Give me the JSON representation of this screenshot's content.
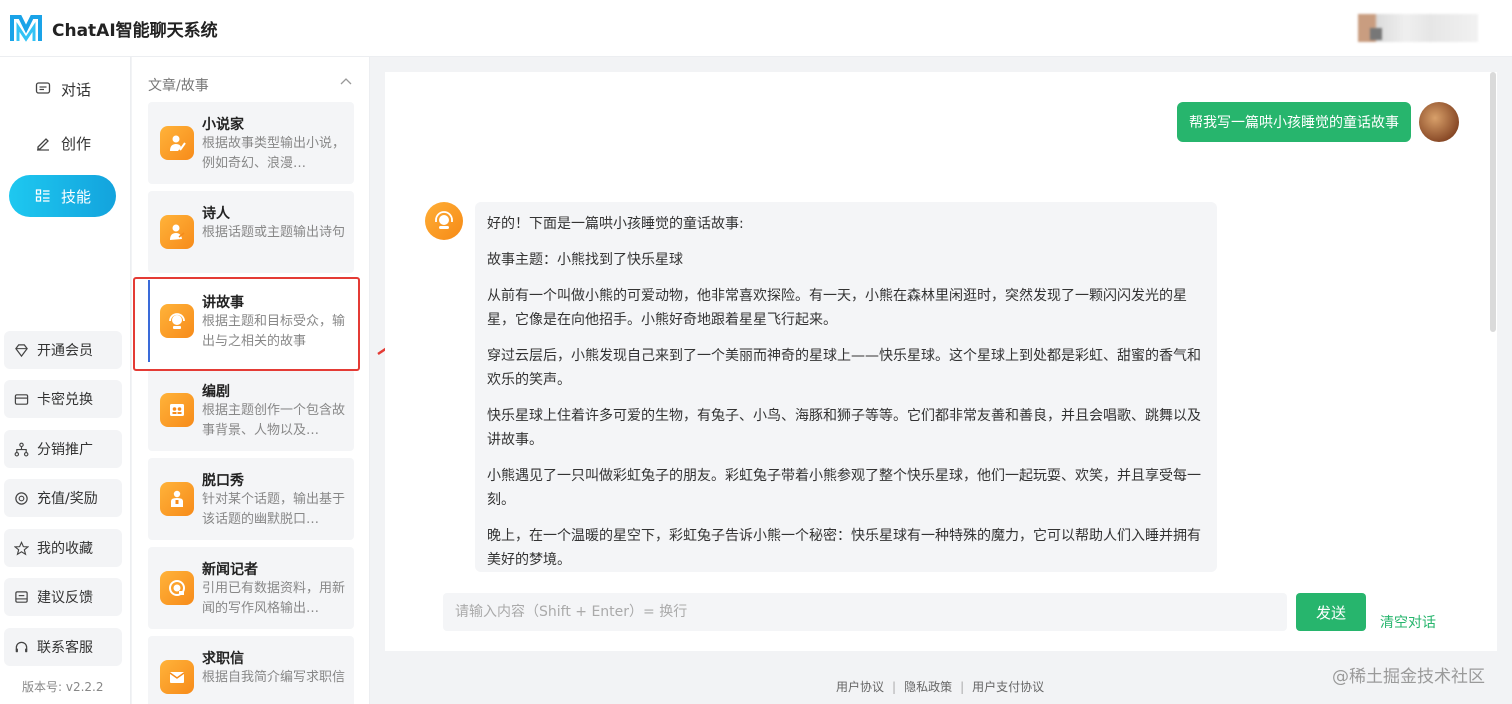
{
  "header": {
    "app_title": "ChatAI智能聊天系统",
    "logo_icon": "m-logo-icon"
  },
  "leftnav": {
    "items": [
      {
        "label": "对话",
        "icon": "chat-icon",
        "active": false
      },
      {
        "label": "创作",
        "icon": "pencil-icon",
        "active": false
      },
      {
        "label": "技能",
        "icon": "skills-grid-icon",
        "active": true
      }
    ],
    "buttons": [
      {
        "label": "开通会员",
        "icon": "diamond-icon"
      },
      {
        "label": "卡密兑换",
        "icon": "card-icon"
      },
      {
        "label": "分销推广",
        "icon": "share-tree-icon"
      },
      {
        "label": "充值/奖励",
        "icon": "coin-icon"
      },
      {
        "label": "我的收藏",
        "icon": "star-icon"
      },
      {
        "label": "建议反馈",
        "icon": "feedback-icon"
      },
      {
        "label": "联系客服",
        "icon": "headset-icon"
      }
    ],
    "version": "版本号: v2.2.2"
  },
  "skills": {
    "category": "文章/故事",
    "cards": [
      {
        "title": "小说家",
        "desc": "根据故事类型输出小说，例如奇幻、浪漫…"
      },
      {
        "title": "诗人",
        "desc": "根据话题或主题输出诗句"
      },
      {
        "title": "讲故事",
        "desc": "根据主题和目标受众，输出与之相关的故事"
      },
      {
        "title": "编剧",
        "desc": "根据主题创作一个包含故事背景、人物以及…"
      },
      {
        "title": "脱口秀",
        "desc": "针对某个话题，输出基于该话题的幽默脱口…"
      },
      {
        "title": "新闻记者",
        "desc": "引用已有数据资料，用新闻的写作风格输出…"
      },
      {
        "title": "求职信",
        "desc": "根据自我简介编写求职信"
      }
    ]
  },
  "chat": {
    "user_message": "帮我写一篇哄小孩睡觉的童话故事",
    "bot_paragraphs": [
      "好的！下面是一篇哄小孩睡觉的童话故事:",
      "故事主题：小熊找到了快乐星球",
      "从前有一个叫做小熊的可爱动物，他非常喜欢探险。有一天，小熊在森林里闲逛时，突然发现了一颗闪闪发光的星星，它像是在向他招手。小熊好奇地跟着星星飞行起来。",
      "穿过云层后，小熊发现自己来到了一个美丽而神奇的星球上——快乐星球。这个星球上到处都是彩虹、甜蜜的香气和欢乐的笑声。",
      "快乐星球上住着许多可爱的生物，有兔子、小鸟、海豚和狮子等等。它们都非常友善和善良，并且会唱歌、跳舞以及讲故事。",
      "小熊遇见了一只叫做彩虹兔子的朋友。彩虹兔子带着小熊参观了整个快乐星球，他们一起玩耍、欢笑，并且享受每一刻。",
      "晚上，在一个温暖的星空下，彩虹兔子告诉小熊一个秘密：快乐星球有一种特殊的魔力，它可以帮助人们入睡并拥有美好的梦境。"
    ],
    "input_placeholder": "请输入内容（Shift + Enter）= 换行",
    "send_label": "发送",
    "clear_label": "清空对话"
  },
  "footer": {
    "links": [
      "用户协议",
      "隐私政策",
      "用户支付协议"
    ]
  },
  "watermark": "@稀土掘金技术社区",
  "colors": {
    "accent_green": "#27b56d",
    "active_nav": "#13a3dd",
    "icon_orange": "#f78b1a",
    "highlight_red": "#e43b35"
  }
}
